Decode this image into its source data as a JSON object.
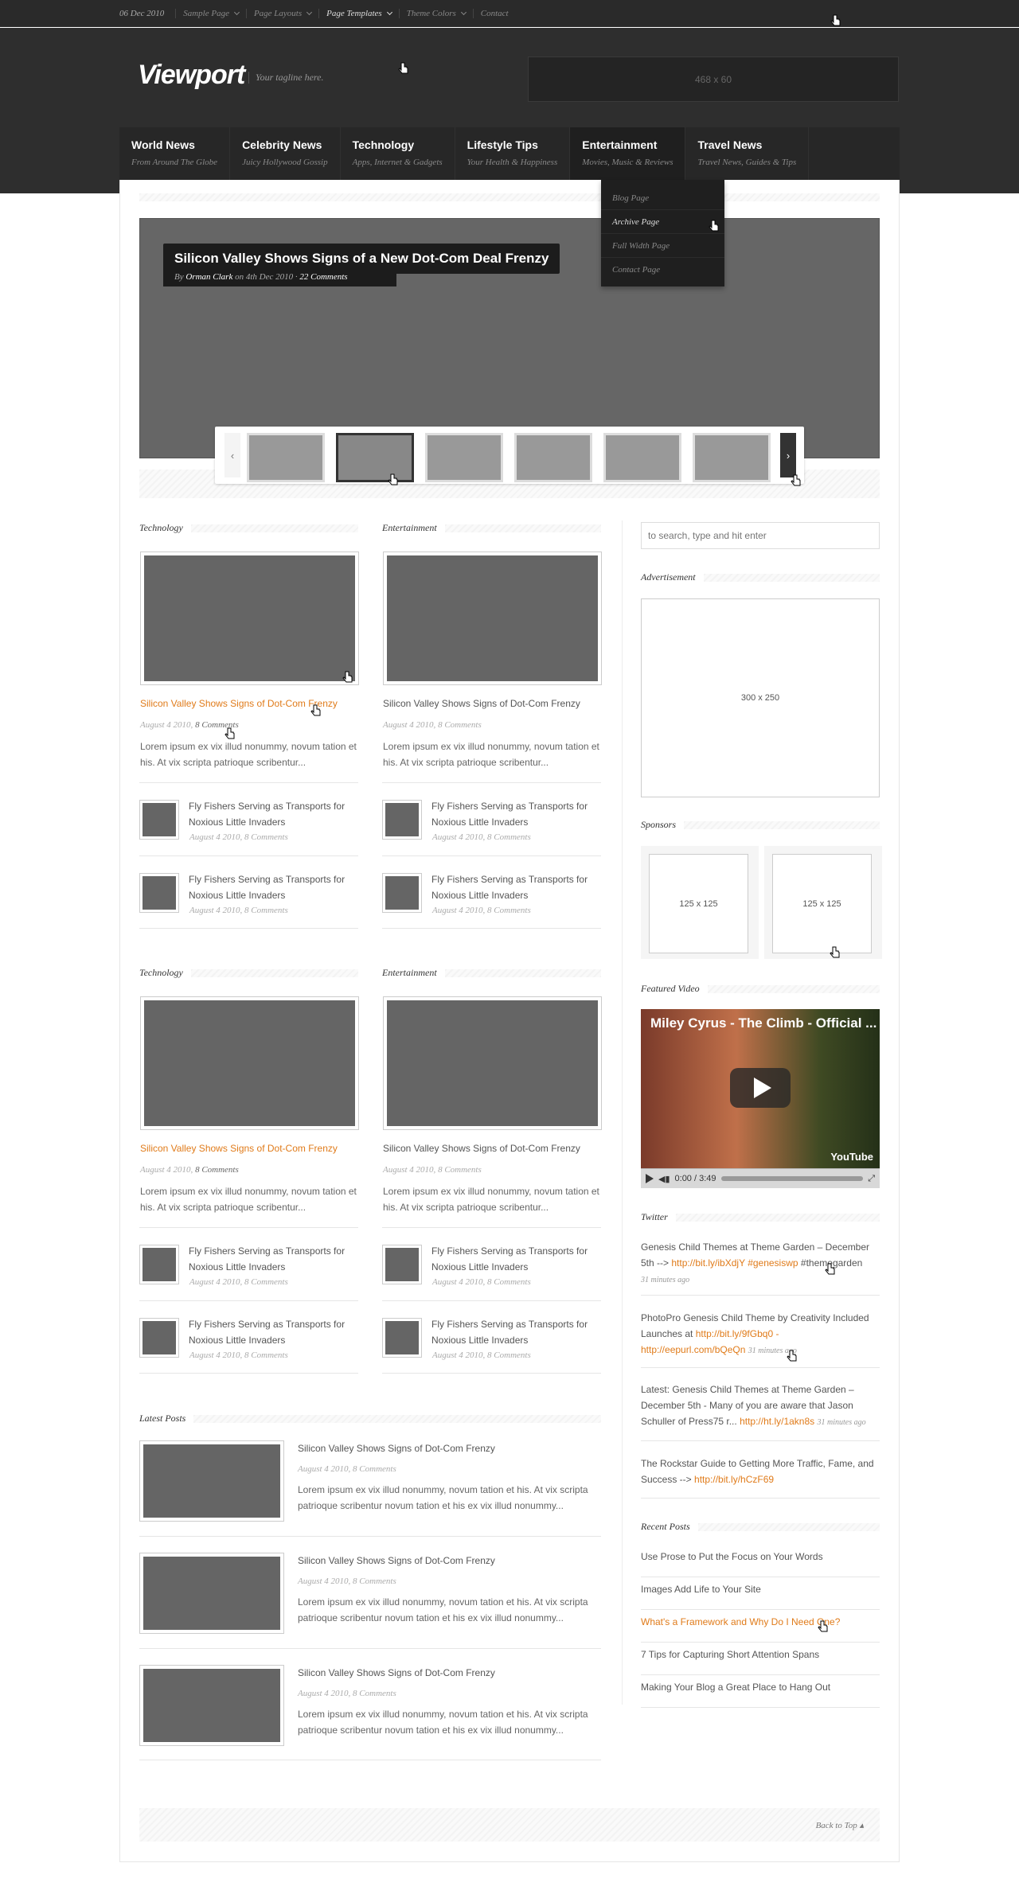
{
  "topbar": {
    "date": "06 Dec 2010",
    "links": [
      "Sample Page",
      "Page Layouts",
      "Page Templates",
      "Theme Colors",
      "Contact"
    ]
  },
  "header": {
    "logo": "Viewport",
    "tagline": "Your tagline here.",
    "banner": "468 x 60"
  },
  "nav": [
    {
      "title": "World News",
      "sub": "From Around The Globe"
    },
    {
      "title": "Celebrity News",
      "sub": "Juicy Hollywood Gossip"
    },
    {
      "title": "Technology",
      "sub": "Apps, Internet & Gadgets"
    },
    {
      "title": "Lifestyle Tips",
      "sub": "Your Health & Happiness"
    },
    {
      "title": "Entertainment",
      "sub": "Movies, Music & Reviews"
    },
    {
      "title": "Travel News",
      "sub": "Travel News, Guides & Tips"
    }
  ],
  "dropdown": [
    "Blog Page",
    "Archive Page",
    "Full Width Page",
    "Contact Page"
  ],
  "slider": {
    "title": "Silicon Valley Shows Signs of a New Dot-Com Deal Frenzy",
    "by": "By",
    "author": "Orman Clark",
    "on": "on 4th Dec 2010 ·",
    "comments": "22 Comments",
    "prev": "‹",
    "next": "›"
  },
  "sections": {
    "technology": "Technology",
    "entertainment": "Entertainment",
    "latest": "Latest Posts"
  },
  "post": {
    "title": "Silicon Valley Shows Signs of Dot-Com Frenzy",
    "date": "August 4 2010,",
    "comments": "8 Comments",
    "excerpt": "Lorem ipsum ex vix illud nonummy, novum tation et his. At vix scripta patrioque scribentur..."
  },
  "small_post": {
    "title": "Fly Fishers Serving as Transports for Noxious Little Invaders",
    "meta": "August 4 2010, 8 Comments"
  },
  "latest": {
    "title": "Silicon Valley Shows Signs of Dot-Com Frenzy",
    "meta": "August 4 2010, 8 Comments",
    "excerpt": "Lorem ipsum ex vix illud nonummy, novum tation et his. At vix scripta patrioque scribentur novum tation et his ex vix illud nonummy..."
  },
  "sidebar": {
    "search_placeholder": "to search, type and hit enter",
    "advertisement": "Advertisement",
    "ad_size": "300 x 250",
    "sponsors": "Sponsors",
    "sponsor_size": "125 x 125",
    "featured_video": "Featured Video",
    "video_title": "Miley Cyrus - The Climb - Official ...",
    "video_time": "0:00 / 3:49",
    "youtube": "YouTube",
    "twitter": "Twitter",
    "tweets": [
      {
        "text": "Genesis Child Themes at Theme Garden – December 5th -->",
        "link": "http://bit.ly/ibXdjY #genesiswp",
        "tail": "#themegarden",
        "time": "31 minutes ago"
      },
      {
        "text": "PhotoPro Genesis Child Theme by Creativity Included Launches at",
        "link": "http://bit.ly/9fGbq0 - http://eepurl.com/bQeQn",
        "tail": "",
        "time": "31 minutes ago"
      },
      {
        "text": "Latest: Genesis Child Themes at Theme Garden – December 5th - Many of you are aware that Jason Schuller of Press75 r...",
        "link": "http://ht.ly/1akn8s",
        "tail": "",
        "time": "31 minutes ago"
      },
      {
        "text": "The Rockstar Guide to Getting More Traffic, Fame, and Success -->",
        "link": "http://bit.ly/hCzF69",
        "tail": "",
        "time": ""
      }
    ],
    "recent_posts": "Recent Posts",
    "recent": [
      "Use Prose to Put the Focus on Your Words",
      "Images Add Life to Your Site",
      "What's a Framework and Why Do I Need One?",
      "7 Tips for Capturing Short Attention Spans",
      "Making Your Blog a Great Place to Hang Out"
    ]
  },
  "footer": {
    "back_to_top": "Back to Top"
  },
  "colors": {
    "accent": "#e07b1a",
    "header": "#2e2e2e",
    "nav": "#272727"
  }
}
